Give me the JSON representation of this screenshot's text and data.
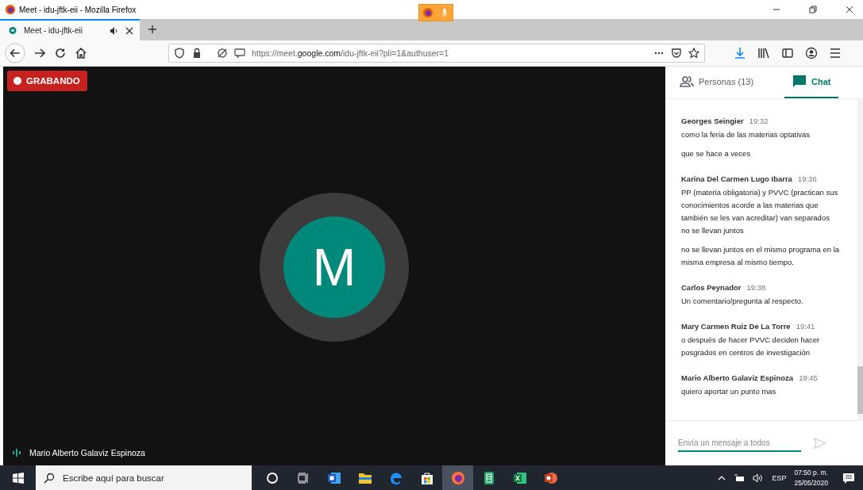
{
  "window": {
    "title": "Meet - idu-jftk-eii - Mozilla Firefox"
  },
  "tabs": [
    {
      "label": "Meet - idu-jftk-eii",
      "selected": true
    }
  ],
  "address_bar": {
    "url": "https://meet.**google.com**/idu-jftk-eii?pli=1&authuser=1"
  },
  "video": {
    "recording_label": "GRABANDO",
    "avatar_letter": "M",
    "participant_name": "Mario Alberto Galaviz Espinoza"
  },
  "side_tabs": [
    {
      "label": "Personas (13)",
      "kind": "people",
      "selected": false
    },
    {
      "label": "Chat",
      "kind": "chat",
      "selected": true
    }
  ],
  "chat": {
    "groups": [
      {
        "sender": "Georges Seingier",
        "time": "19:32",
        "messages": [
          "como la feria de las materias optativas",
          "que se hace a veces"
        ]
      },
      {
        "sender": "Karina Del Carmen Lugo Ibarra",
        "time": "19:36",
        "messages": [
          "PP (materia obligatoria) y PVVC (practican sus conocimientos acorde a las materias que también se les van acreditar) van separados no se llevan juntos",
          "no se llevan juntos en el mismo programa en la misma empresa al mismo tiempo."
        ]
      },
      {
        "sender": "Carlos Peynador",
        "time": "19:38",
        "messages": [
          "Un comentario/pregunta al respecto."
        ]
      },
      {
        "sender": "Mary Carmen Ruiz De La Torre",
        "time": "19:41",
        "messages": [
          "o después de hacer PVVC deciden hacer posgrados en centros de investigación"
        ]
      },
      {
        "sender": "Mario Alberto Galaviz Espinoza",
        "time": "19:45",
        "messages": [
          "quiero aportar un punto mas"
        ]
      }
    ],
    "input_placeholder": "Envía un mensaje a todos"
  },
  "taskbar": {
    "search_placeholder": "Escribe aquí para buscar",
    "apps": [
      {
        "kind": "cortana",
        "selected": false
      },
      {
        "kind": "taskview",
        "selected": false
      },
      {
        "kind": "word",
        "selected": false
      },
      {
        "kind": "explorer",
        "selected": false
      },
      {
        "kind": "edge",
        "selected": false
      },
      {
        "kind": "store",
        "selected": false
      },
      {
        "kind": "firefox",
        "selected": true
      },
      {
        "kind": "sheets",
        "selected": false
      },
      {
        "kind": "excel",
        "selected": false
      },
      {
        "kind": "powerpoint",
        "selected": false
      }
    ],
    "language": "ESP",
    "time": "07:50 p. m.",
    "date": "25/05/2020"
  }
}
